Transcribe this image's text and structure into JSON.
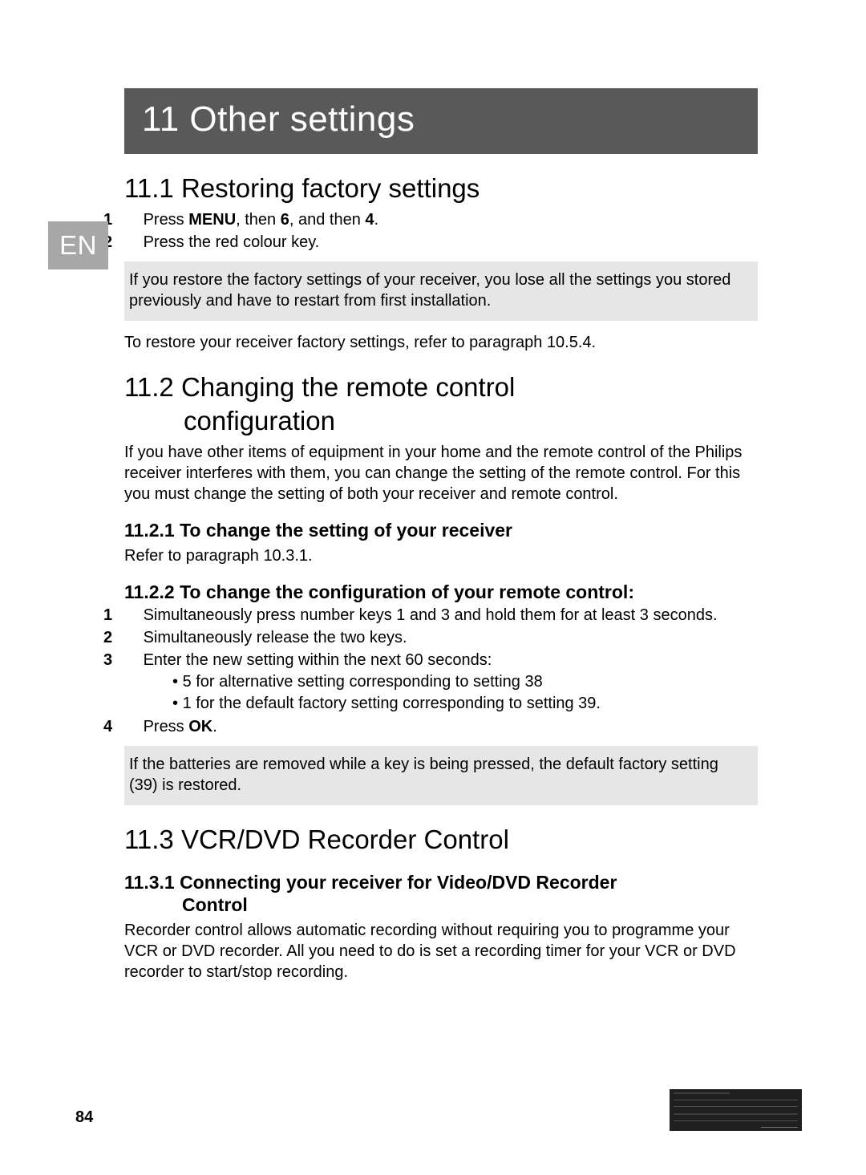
{
  "language_tab": "EN",
  "chapter": {
    "number": "11",
    "title": "Other settings"
  },
  "page_number": "84",
  "sections": {
    "s1": {
      "heading": "11.1 Restoring factory settings",
      "step1_num": "1",
      "step1_a": "Press ",
      "step1_b": "MENU",
      "step1_c": ", then ",
      "step1_d": "6",
      "step1_e": ", and then ",
      "step1_f": "4",
      "step1_g": ".",
      "step2_num": "2",
      "step2": "Press the red colour key.",
      "note": "If you restore the factory settings of your receiver, you lose all the settings you stored previously and have to restart from first installation.",
      "after_note": "To restore your receiver factory settings, refer to paragraph 10.5.4."
    },
    "s2": {
      "heading_line1": "11.2 Changing the remote control",
      "heading_line2": "configuration",
      "intro": "If you have other items of equipment in your home and the remote control of the Philips receiver interferes with them, you can change the setting of the remote control. For this you must change the setting of both your receiver and remote control.",
      "sub1_heading": "11.2.1 To change the setting of your receiver",
      "sub1_body": "Refer to paragraph 10.3.1.",
      "sub2_heading": "11.2.2 To change the configuration of your remote control:",
      "sub2_step1_num": "1",
      "sub2_step1": "Simultaneously press number keys 1 and 3 and hold them for at least 3 seconds.",
      "sub2_step2_num": "2",
      "sub2_step2": "Simultaneously release the two keys.",
      "sub2_step3_num": "3",
      "sub2_step3": "Enter the new setting within the next 60 seconds:",
      "sub2_bullet1": "5 for alternative setting corresponding to setting 38",
      "sub2_bullet2": "1 for the default factory setting corresponding to setting 39.",
      "sub2_step4_num": "4",
      "sub2_step4_a": "Press ",
      "sub2_step4_b": "OK",
      "sub2_step4_c": ".",
      "note": "If the batteries are removed while a key is being pressed, the default factory setting (39) is restored."
    },
    "s3": {
      "heading": "11.3 VCR/DVD Recorder Control",
      "sub1_heading_line1": "11.3.1 Connecting your receiver for Video/DVD Recorder",
      "sub1_heading_line2": "Control",
      "sub1_body": "Recorder control allows automatic recording without requiring you to programme your VCR or DVD recorder. All you need to do is set a recording timer for your VCR or DVD recorder to start/stop recording."
    }
  }
}
